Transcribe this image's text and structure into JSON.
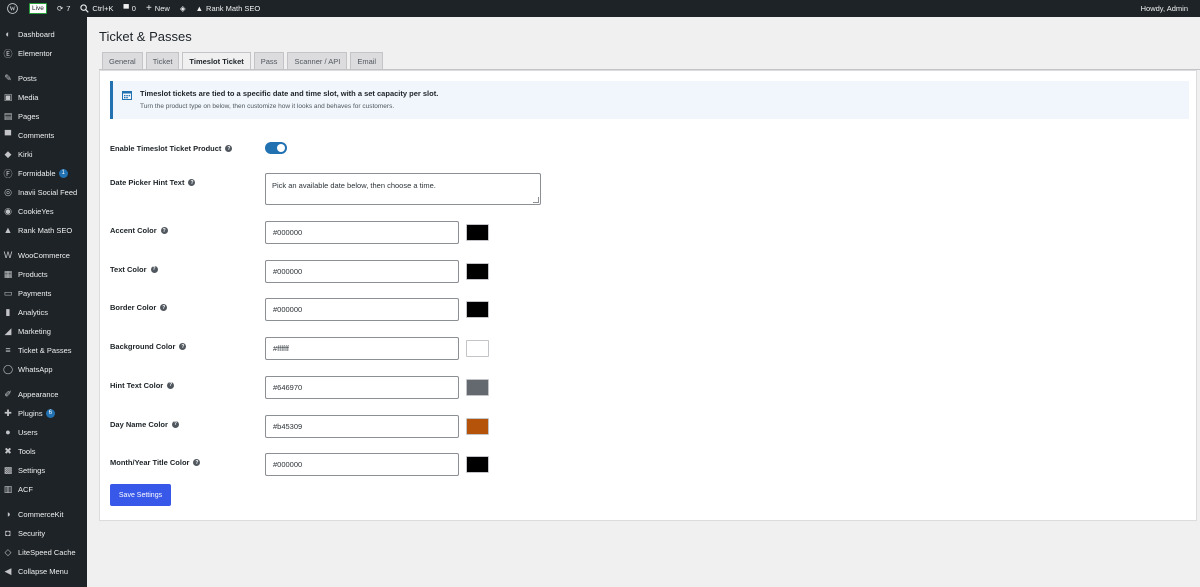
{
  "adminbar": {
    "live_badge": "Live",
    "updates_count": "7",
    "search_shortcut": "Ctrl+K",
    "comments_count": "0",
    "new_label": "New",
    "rank_math_label": "Rank Math SEO",
    "greeting": "Howdy, Admin"
  },
  "sidebar": {
    "items": [
      {
        "label": "Dashboard",
        "icon": "dashboard-icon",
        "glyph": "◐"
      },
      {
        "label": "Elementor",
        "icon": "elementor-icon",
        "glyph": "Ⓔ"
      },
      {
        "label": "Posts",
        "icon": "pin-icon",
        "glyph": "✎"
      },
      {
        "label": "Media",
        "icon": "media-icon",
        "glyph": "▣"
      },
      {
        "label": "Pages",
        "icon": "pages-icon",
        "glyph": "▤"
      },
      {
        "label": "Comments",
        "icon": "comments-icon",
        "glyph": "▀"
      },
      {
        "label": "Kirki",
        "icon": "kirki-icon",
        "glyph": "◆"
      },
      {
        "label": "Formidable",
        "icon": "formidable-icon",
        "glyph": "Ⓕ",
        "badge": "1"
      },
      {
        "label": "Inavii Social Feed",
        "icon": "inavii-icon",
        "glyph": "◎"
      },
      {
        "label": "CookieYes",
        "icon": "cookieyes-icon",
        "glyph": "◉"
      },
      {
        "label": "Rank Math SEO",
        "icon": "rank-math-icon",
        "glyph": "▲"
      },
      {
        "label": "WooCommerce",
        "icon": "woocommerce-icon",
        "glyph": "W"
      },
      {
        "label": "Products",
        "icon": "products-icon",
        "glyph": "▦"
      },
      {
        "label": "Payments",
        "icon": "payments-icon",
        "glyph": "▭"
      },
      {
        "label": "Analytics",
        "icon": "analytics-icon",
        "glyph": "▮"
      },
      {
        "label": "Marketing",
        "icon": "marketing-icon",
        "glyph": "◢"
      },
      {
        "label": "Ticket & Passes",
        "icon": "ticket-icon",
        "glyph": "≡"
      },
      {
        "label": "WhatsApp",
        "icon": "whatsapp-icon",
        "glyph": "◯"
      },
      {
        "label": "Appearance",
        "icon": "appearance-icon",
        "glyph": "✐"
      },
      {
        "label": "Plugins",
        "icon": "plugins-icon",
        "glyph": "✚",
        "badge": "6"
      },
      {
        "label": "Users",
        "icon": "users-icon",
        "glyph": "●"
      },
      {
        "label": "Tools",
        "icon": "tools-icon",
        "glyph": "✖"
      },
      {
        "label": "Settings",
        "icon": "settings-icon",
        "glyph": "▩"
      },
      {
        "label": "ACF",
        "icon": "acf-icon",
        "glyph": "▥"
      },
      {
        "label": "CommerceKit",
        "icon": "commercekit-icon",
        "glyph": "◑"
      },
      {
        "label": "Security",
        "icon": "security-icon",
        "glyph": "◘"
      },
      {
        "label": "LiteSpeed Cache",
        "icon": "litespeed-icon",
        "glyph": "◇"
      },
      {
        "label": "Collapse Menu",
        "icon": "collapse-icon",
        "glyph": "◀"
      }
    ]
  },
  "page": {
    "title": "Ticket & Passes",
    "tabs": [
      {
        "label": "General"
      },
      {
        "label": "Ticket"
      },
      {
        "label": "Timeslot Ticket",
        "active": true
      },
      {
        "label": "Pass"
      },
      {
        "label": "Scanner / API"
      },
      {
        "label": "Email"
      }
    ]
  },
  "notice": {
    "title": "Timeslot tickets are tied to a specific date and time slot, with a set capacity per slot.",
    "subtitle": "Turn the product type on below, then customize how it looks and behaves for customers."
  },
  "form": {
    "enable_label": "Enable Timeslot Ticket Product",
    "enable_value": true,
    "hint_label": "Date Picker Hint Text",
    "hint_value": "Pick an available date below, then choose a time.",
    "colors": [
      {
        "label": "Accent Color",
        "value": "#000000"
      },
      {
        "label": "Text Color",
        "value": "#000000"
      },
      {
        "label": "Border Color",
        "value": "#000000"
      },
      {
        "label": "Background Color",
        "value": "#ffffff"
      },
      {
        "label": "Hint Text Color",
        "value": "#646970"
      },
      {
        "label": "Day Name Color",
        "value": "#b45309"
      },
      {
        "label": "Month/Year Title Color",
        "value": "#000000"
      }
    ],
    "save_label": "Save Settings"
  },
  "theme": {
    "accent": "#2271b1",
    "save_button": "#3858e9",
    "adminbar_bg": "#1d2327"
  }
}
